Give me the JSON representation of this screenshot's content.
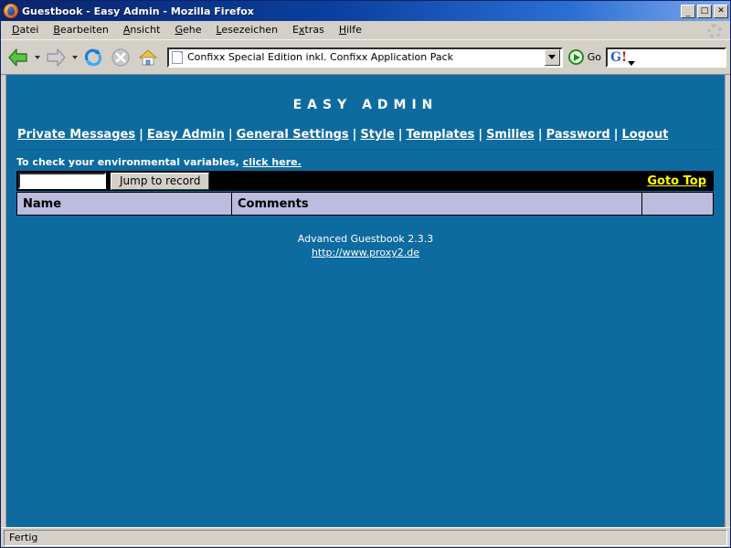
{
  "window": {
    "title": "Guestbook - Easy Admin - Mozilla Firefox",
    "app_icon": "firefox-icon",
    "minimize_label": "_",
    "maximize_label": "□",
    "close_label": "✕"
  },
  "menubar": {
    "items": [
      {
        "label": "Datei",
        "accel": "D"
      },
      {
        "label": "Bearbeiten",
        "accel": "B"
      },
      {
        "label": "Ansicht",
        "accel": "A"
      },
      {
        "label": "Gehe",
        "accel": "G"
      },
      {
        "label": "Lesezeichen",
        "accel": "L"
      },
      {
        "label": "Extras",
        "accel": "x"
      },
      {
        "label": "Hilfe",
        "accel": "H"
      }
    ]
  },
  "toolbar": {
    "back_icon": "back-arrow-icon",
    "forward_icon": "forward-arrow-icon",
    "reload_icon": "reload-icon",
    "stop_icon": "stop-icon",
    "home_icon": "home-icon",
    "url_value": "Confixx Special Edition inkl. Confixx Application Pack",
    "url_placeholder": "",
    "go_label": "Go",
    "go_icon": "go-arrow-icon",
    "search_value": "",
    "search_placeholder": "",
    "search_engine_logo": "google-g-logo"
  },
  "page": {
    "heading": "EASY ADMIN",
    "nav": [
      {
        "label": "Private Messages"
      },
      {
        "label": "Easy Admin"
      },
      {
        "label": "General Settings"
      },
      {
        "label": "Style"
      },
      {
        "label": "Templates"
      },
      {
        "label": "Smilies"
      },
      {
        "label": "Password"
      },
      {
        "label": "Logout"
      }
    ],
    "nav_separator": "|",
    "env_text": "To check your environmental variables, ",
    "env_link": "click here.",
    "jump_input_value": "",
    "jump_button_label": "Jump to record",
    "goto_top_label": "Goto Top",
    "table": {
      "headers": [
        "Name",
        "Comments",
        ""
      ],
      "rows": []
    },
    "footer_text": "Advanced Guestbook 2.3.3",
    "footer_link": "http://www.proxy2.de"
  },
  "statusbar": {
    "text": "Fertig"
  },
  "colors": {
    "page_background": "#0e6ba0",
    "table_header": "#bcbcdf",
    "goto_top": "#ffff00",
    "bar_background": "#000000",
    "chrome": "#d4d0c8",
    "titlebar": "#0a246a"
  }
}
